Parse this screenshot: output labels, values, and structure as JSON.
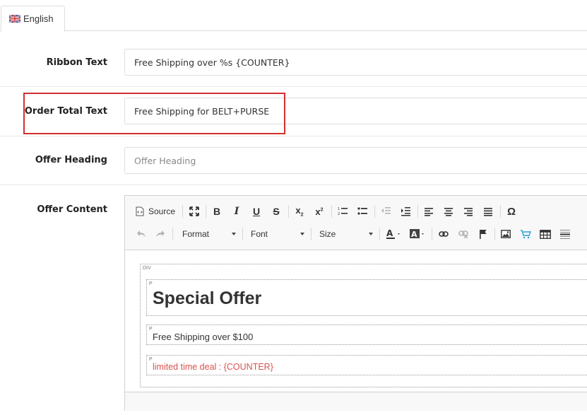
{
  "tabs": [
    {
      "label": "English",
      "icon": "uk-flag-icon"
    }
  ],
  "form": {
    "ribbon_text": {
      "label": "Ribbon Text",
      "value": "Free Shipping over %s {COUNTER}"
    },
    "order_total_text": {
      "label": "Order Total Text",
      "value": "Free Shipping for BELT+PURSE"
    },
    "offer_heading": {
      "label": "Offer Heading",
      "value": "",
      "placeholder": "Offer Heading"
    },
    "offer_content": {
      "label": "Offer Content"
    }
  },
  "editor": {
    "toolbar": {
      "source_label": "Source",
      "format_label": "Format",
      "font_label": "Font",
      "size_label": "Size"
    },
    "content": {
      "div_tag": "DIV",
      "p_tag": "P",
      "heading": "Special Offer",
      "line1": "Free Shipping over $100",
      "line2": "limited time deal : {COUNTER}"
    }
  },
  "colors": {
    "highlight": "#d32f2f",
    "deal_text": "#d9534f"
  }
}
